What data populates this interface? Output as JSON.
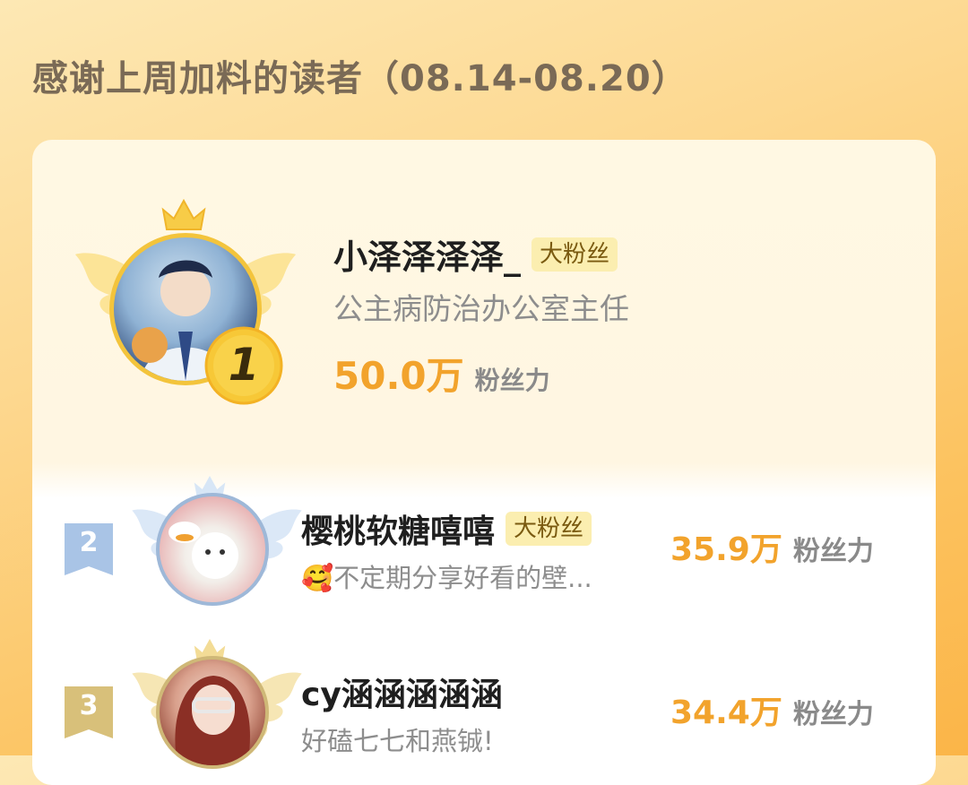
{
  "header": {
    "title": "感谢上周加料的读者（08.14-08.20）"
  },
  "ranking": [
    {
      "rank": "1",
      "name": "小泽泽泽泽_",
      "badge": "大粉丝",
      "desc": "公主病防治办公室主任",
      "fans_value": "50.0万",
      "fans_unit": "粉丝力"
    },
    {
      "rank": "2",
      "name": "樱桃软糖嘻嘻",
      "badge": "大粉丝",
      "emoji": "🥰",
      "desc": "不定期分享好看的壁...",
      "fans_value": "35.9万",
      "fans_unit": "粉丝力"
    },
    {
      "rank": "3",
      "name": "cy涵涵涵涵涵",
      "desc": "好磕七七和燕铖!",
      "fans_value": "34.4万",
      "fans_unit": "粉丝力"
    }
  ],
  "colors": {
    "accent": "#f2a32c",
    "gold": "#f5c23a",
    "silver": "#a9c4e6",
    "bronze": "#d8c07a"
  },
  "icons": [
    "crown-icon",
    "wings-icon",
    "rank-badge-icon",
    "emoji-icon"
  ]
}
